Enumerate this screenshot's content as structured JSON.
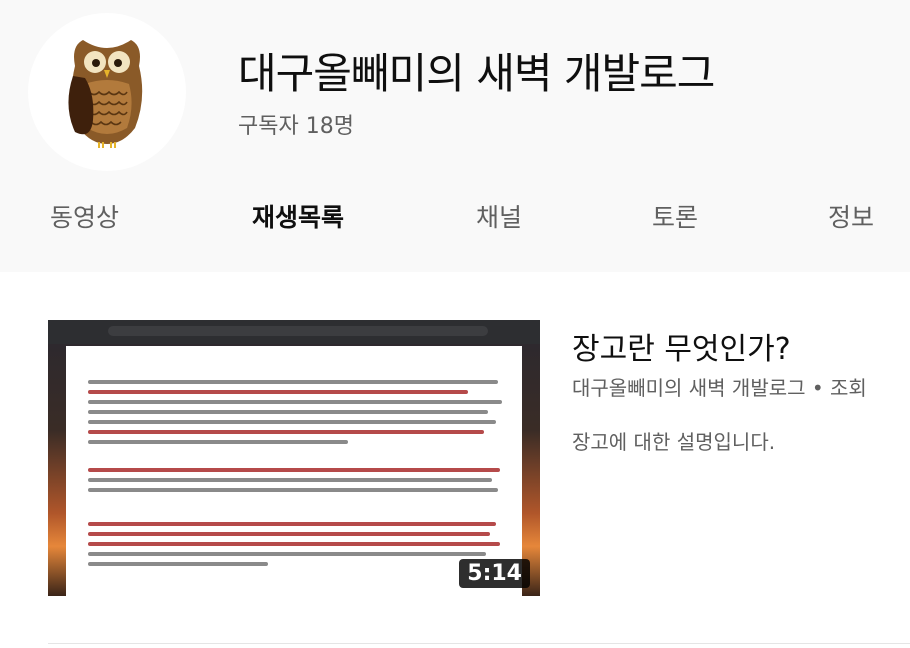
{
  "channel": {
    "name": "대구올빼미의 새벽 개발로그",
    "subscribers": "구독자 18명",
    "avatar_icon": "owl-icon"
  },
  "tabs": [
    {
      "label": "동영상",
      "active": false
    },
    {
      "label": "재생목록",
      "active": true
    },
    {
      "label": "채널",
      "active": false
    },
    {
      "label": "토론",
      "active": false
    },
    {
      "label": "정보",
      "active": false
    }
  ],
  "video": {
    "title": "장고란 무엇인가?",
    "meta": "대구올빼미의 새벽 개발로그 • 조회",
    "description": "장고에 대한 설명입니다.",
    "duration": "5:14"
  }
}
